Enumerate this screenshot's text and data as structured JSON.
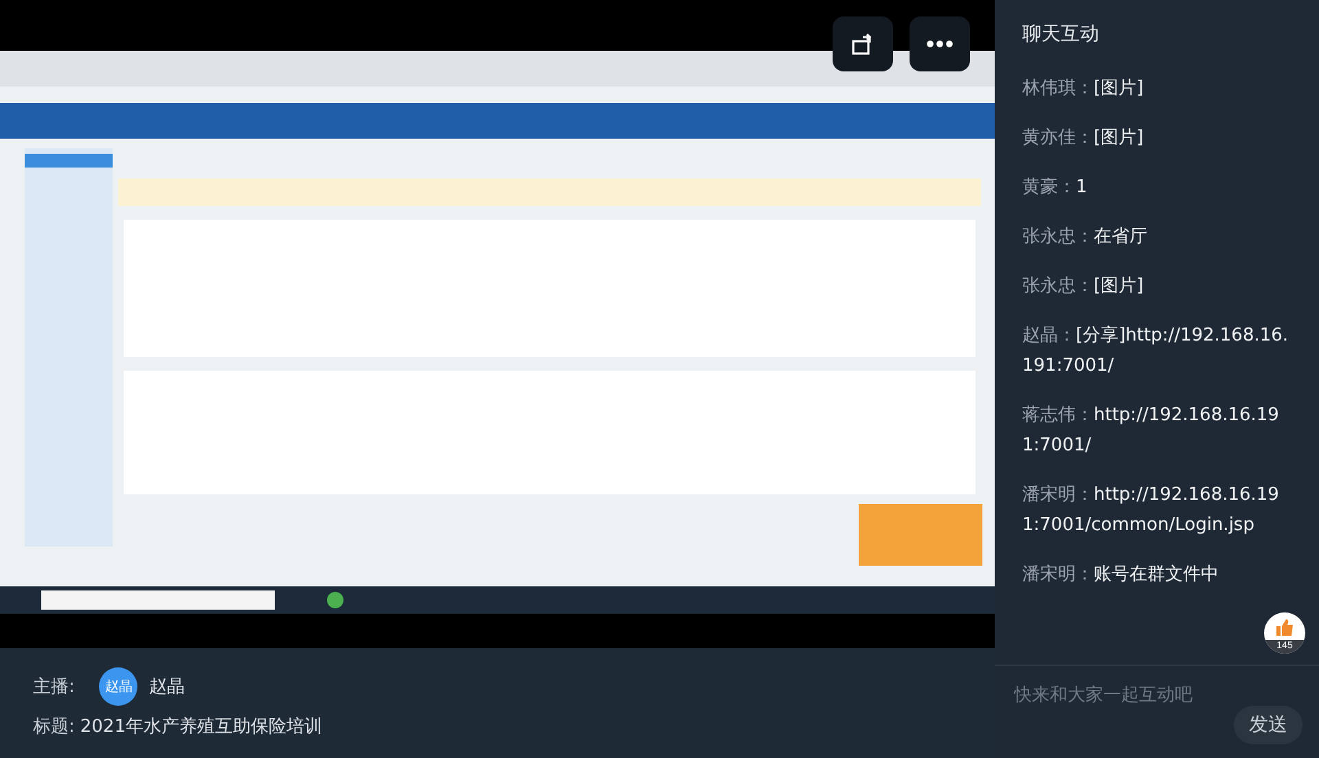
{
  "overlay_buttons": [
    {
      "kind": "rotate"
    },
    {
      "kind": "more"
    }
  ],
  "host": {
    "label": "主播:",
    "avatar_text": "赵晶",
    "name": "赵晶"
  },
  "title": {
    "label": "标题:",
    "value": "2021年水产养殖互助保险培训"
  },
  "chat": {
    "heading": "聊天互动",
    "messages": [
      {
        "author": "林伟琪：",
        "text": "[图片]"
      },
      {
        "author": "黄亦佳：",
        "text": "[图片]"
      },
      {
        "author": "黄豪：",
        "text": "1"
      },
      {
        "author": "张永忠：",
        "text": "在省厅"
      },
      {
        "author": "张永忠：",
        "text": "[图片]"
      },
      {
        "author": "赵晶：",
        "text": "[分享]http://192.168.16.191:7001/"
      },
      {
        "author": "蒋志伟：",
        "text": "http://192.168.16.191:7001/"
      },
      {
        "author": "潘宋明：",
        "text": "http://192.168.16.191:7001/common/Login.jsp"
      },
      {
        "author": "潘宋明：",
        "text": "账号在群文件中"
      }
    ],
    "likes": "145",
    "input": {
      "placeholder": "快来和大家一起互动吧"
    },
    "send": "发送"
  }
}
